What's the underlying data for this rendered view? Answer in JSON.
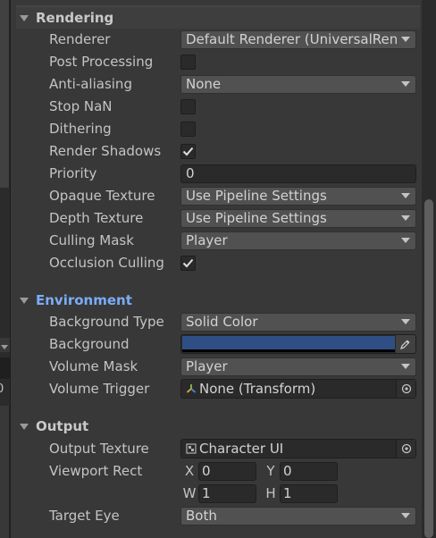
{
  "colors": {
    "background_color": "#2F4F84",
    "environment_header": "#7CACF8"
  },
  "left_panel": {
    "zero_text": "0"
  },
  "rendering": {
    "title": "Rendering",
    "renderer": {
      "label": "Renderer",
      "value": "Default Renderer (UniversalRende"
    },
    "post_processing": {
      "label": "Post Processing",
      "checked": false
    },
    "anti_aliasing": {
      "label": "Anti-aliasing",
      "value": "None"
    },
    "stop_nan": {
      "label": "Stop NaN",
      "checked": false
    },
    "dithering": {
      "label": "Dithering",
      "checked": false
    },
    "render_shadows": {
      "label": "Render Shadows",
      "checked": true
    },
    "priority": {
      "label": "Priority",
      "value": "0"
    },
    "opaque_texture": {
      "label": "Opaque Texture",
      "value": "Use Pipeline Settings"
    },
    "depth_texture": {
      "label": "Depth Texture",
      "value": "Use Pipeline Settings"
    },
    "culling_mask": {
      "label": "Culling Mask",
      "value": "Player"
    },
    "occlusion_culling": {
      "label": "Occlusion Culling",
      "checked": true
    }
  },
  "environment": {
    "title": "Environment",
    "background_type": {
      "label": "Background Type",
      "value": "Solid Color"
    },
    "background": {
      "label": "Background",
      "icon": "eyedropper-icon"
    },
    "volume_mask": {
      "label": "Volume Mask",
      "value": "Player"
    },
    "volume_trigger": {
      "label": "Volume Trigger",
      "value": "None (Transform)",
      "icon": "transform-icon"
    }
  },
  "output": {
    "title": "Output",
    "output_texture": {
      "label": "Output Texture",
      "value": "Character UI",
      "icon": "render-texture-icon"
    },
    "viewport_rect": {
      "label": "Viewport Rect",
      "x_label": "X",
      "x": "0",
      "y_label": "Y",
      "y": "0",
      "w_label": "W",
      "w": "1",
      "h_label": "H",
      "h": "1"
    },
    "target_eye": {
      "label": "Target Eye",
      "value": "Both"
    }
  }
}
